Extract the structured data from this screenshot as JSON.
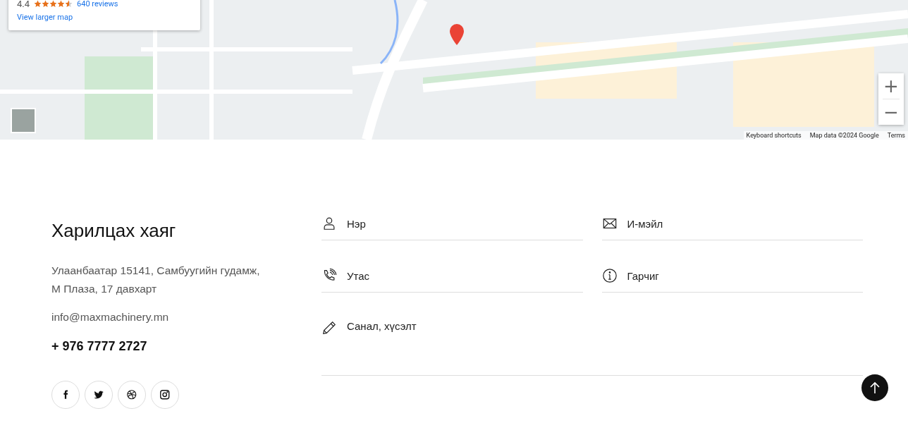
{
  "map": {
    "place_card": {
      "rating": "4.4",
      "stars": 4.5,
      "reviews_link": "640 reviews",
      "larger_map_link": "View larger map"
    },
    "zoom_in": "+",
    "zoom_out": "−",
    "attribution": [
      "Keyboard shortcuts",
      "Map data ©2024 Google",
      "Terms"
    ]
  },
  "contact": {
    "title": "Харилцах хаяг",
    "address": "Улаанбаатар 15141, Самбуугийн гудамж, М Плаза, 17 давхарт",
    "email": "info@maxmachinery.mn",
    "phone": "+ 976 7777 2727",
    "social": [
      {
        "kind": "facebook"
      },
      {
        "kind": "twitter"
      },
      {
        "kind": "dribbble"
      },
      {
        "kind": "instagram"
      }
    ]
  },
  "form": {
    "fields": [
      {
        "kind": "person",
        "placeholder": "Нэр"
      },
      {
        "kind": "mail",
        "placeholder": "И-мэйл"
      },
      {
        "kind": "phone",
        "placeholder": "Утас"
      },
      {
        "kind": "info",
        "placeholder": "Гарчиг"
      },
      {
        "kind": "pencil",
        "placeholder": "Санал, хүсэлт"
      }
    ]
  }
}
